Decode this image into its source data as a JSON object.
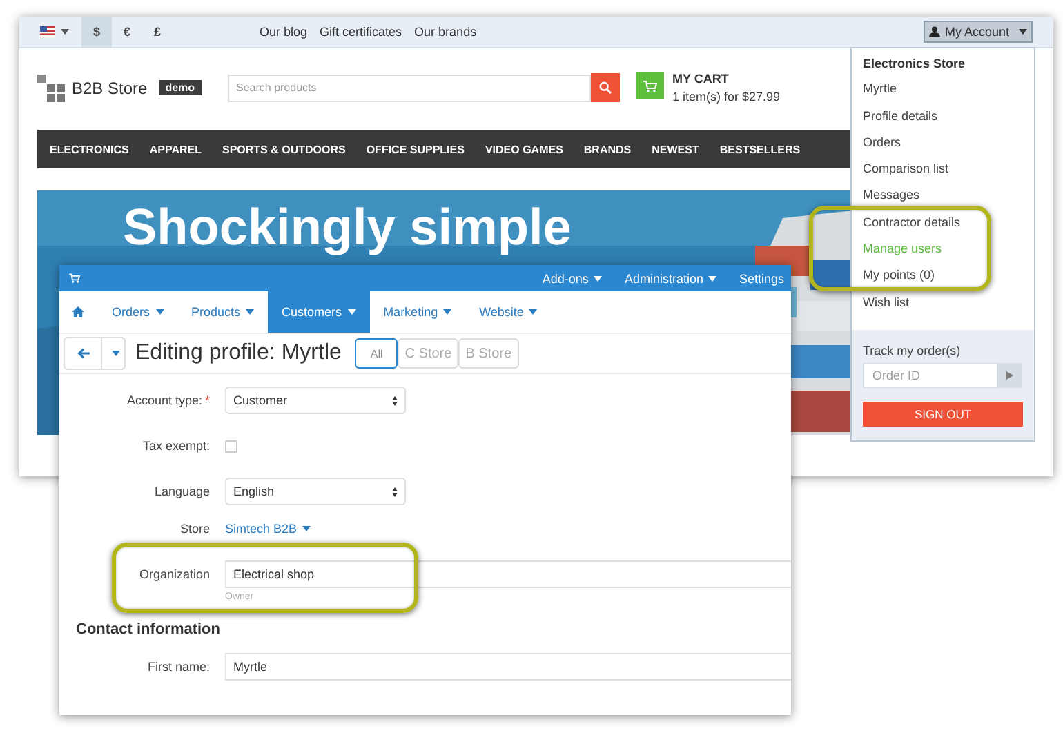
{
  "storefront": {
    "top_bar": {
      "currencies": [
        {
          "label": "$",
          "selected": true
        },
        {
          "label": "€",
          "selected": false
        },
        {
          "label": "£",
          "selected": false
        }
      ],
      "links": [
        "Our blog",
        "Gift certificates",
        "Our brands"
      ],
      "account_button": "My Account"
    },
    "logo": {
      "name": "B2B Store",
      "badge": "demo"
    },
    "search": {
      "placeholder": "Search products"
    },
    "cart": {
      "title": "MY CART",
      "summary": "1 item(s) for $27.99"
    },
    "nav": [
      "ELECTRONICS",
      "APPAREL",
      "SPORTS & OUTDOORS",
      "OFFICE SUPPLIES",
      "VIDEO GAMES",
      "BRANDS",
      "NEWEST",
      "BESTSELLERS"
    ],
    "banner": {
      "headline": "Shockingly simple",
      "kind": "picture"
    }
  },
  "account_menu": {
    "heading": "Electronics Store",
    "items": [
      {
        "label": "Myrtle",
        "selected": false,
        "highlighted": false
      },
      {
        "label": "Profile details",
        "selected": false,
        "highlighted": false
      },
      {
        "label": "Orders",
        "selected": false,
        "highlighted": false
      },
      {
        "label": "Comparison list",
        "selected": false,
        "highlighted": false
      },
      {
        "label": "Messages",
        "selected": false,
        "highlighted": false
      },
      {
        "label": "Contractor details",
        "selected": false,
        "highlighted": true
      },
      {
        "label": "Manage users",
        "selected": true,
        "highlighted": true
      },
      {
        "label": "My points (0)",
        "selected": false,
        "highlighted": true
      },
      {
        "label": "Wish list",
        "selected": false,
        "highlighted": false
      }
    ],
    "track": {
      "label": "Track my order(s)",
      "placeholder": "Order ID"
    },
    "sign_out": "SIGN OUT"
  },
  "admin": {
    "top_menu": [
      {
        "label": "Add-ons",
        "dropdown": true
      },
      {
        "label": "Administration",
        "dropdown": true
      },
      {
        "label": "Settings",
        "dropdown": false
      }
    ],
    "main_menu": [
      {
        "label": "Orders",
        "selected": false
      },
      {
        "label": "Products",
        "selected": false
      },
      {
        "label": "Customers",
        "selected": true
      },
      {
        "label": "Marketing",
        "selected": false
      },
      {
        "label": "Website",
        "selected": false
      }
    ],
    "title": "Editing profile: Myrtle",
    "store_tabs": [
      {
        "label": "All",
        "selected": true
      },
      {
        "label": "C Store",
        "selected": false
      },
      {
        "label": "B Store",
        "selected": false
      }
    ],
    "form": [
      {
        "kind": "select",
        "label": "Account type:",
        "required_mark": "*",
        "value": "Customer"
      },
      {
        "kind": "checkbox",
        "label": "Tax exempt:",
        "checked": false
      },
      {
        "kind": "select",
        "label": "Language",
        "value": "English"
      },
      {
        "kind": "link",
        "label": "Store",
        "value": "Simtech B2B"
      },
      {
        "kind": "text",
        "label": "Organization",
        "value": "Electrical shop",
        "help": "Owner",
        "highlighted": true
      }
    ],
    "section": "Contact information",
    "contact": [
      {
        "kind": "text",
        "label": "First name:",
        "value": "Myrtle"
      }
    ]
  }
}
